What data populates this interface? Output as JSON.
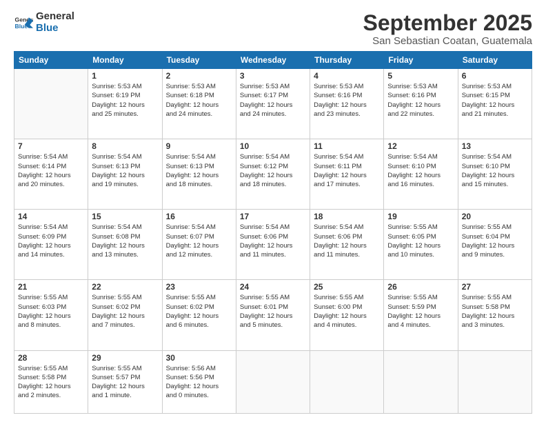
{
  "logo": {
    "text_general": "General",
    "text_blue": "Blue"
  },
  "header": {
    "month": "September 2025",
    "location": "San Sebastian Coatan, Guatemala"
  },
  "days": [
    "Sunday",
    "Monday",
    "Tuesday",
    "Wednesday",
    "Thursday",
    "Friday",
    "Saturday"
  ],
  "weeks": [
    [
      {
        "num": "",
        "lines": []
      },
      {
        "num": "1",
        "lines": [
          "Sunrise: 5:53 AM",
          "Sunset: 6:19 PM",
          "Daylight: 12 hours",
          "and 25 minutes."
        ]
      },
      {
        "num": "2",
        "lines": [
          "Sunrise: 5:53 AM",
          "Sunset: 6:18 PM",
          "Daylight: 12 hours",
          "and 24 minutes."
        ]
      },
      {
        "num": "3",
        "lines": [
          "Sunrise: 5:53 AM",
          "Sunset: 6:17 PM",
          "Daylight: 12 hours",
          "and 24 minutes."
        ]
      },
      {
        "num": "4",
        "lines": [
          "Sunrise: 5:53 AM",
          "Sunset: 6:16 PM",
          "Daylight: 12 hours",
          "and 23 minutes."
        ]
      },
      {
        "num": "5",
        "lines": [
          "Sunrise: 5:53 AM",
          "Sunset: 6:16 PM",
          "Daylight: 12 hours",
          "and 22 minutes."
        ]
      },
      {
        "num": "6",
        "lines": [
          "Sunrise: 5:53 AM",
          "Sunset: 6:15 PM",
          "Daylight: 12 hours",
          "and 21 minutes."
        ]
      }
    ],
    [
      {
        "num": "7",
        "lines": [
          "Sunrise: 5:54 AM",
          "Sunset: 6:14 PM",
          "Daylight: 12 hours",
          "and 20 minutes."
        ]
      },
      {
        "num": "8",
        "lines": [
          "Sunrise: 5:54 AM",
          "Sunset: 6:13 PM",
          "Daylight: 12 hours",
          "and 19 minutes."
        ]
      },
      {
        "num": "9",
        "lines": [
          "Sunrise: 5:54 AM",
          "Sunset: 6:13 PM",
          "Daylight: 12 hours",
          "and 18 minutes."
        ]
      },
      {
        "num": "10",
        "lines": [
          "Sunrise: 5:54 AM",
          "Sunset: 6:12 PM",
          "Daylight: 12 hours",
          "and 18 minutes."
        ]
      },
      {
        "num": "11",
        "lines": [
          "Sunrise: 5:54 AM",
          "Sunset: 6:11 PM",
          "Daylight: 12 hours",
          "and 17 minutes."
        ]
      },
      {
        "num": "12",
        "lines": [
          "Sunrise: 5:54 AM",
          "Sunset: 6:10 PM",
          "Daylight: 12 hours",
          "and 16 minutes."
        ]
      },
      {
        "num": "13",
        "lines": [
          "Sunrise: 5:54 AM",
          "Sunset: 6:10 PM",
          "Daylight: 12 hours",
          "and 15 minutes."
        ]
      }
    ],
    [
      {
        "num": "14",
        "lines": [
          "Sunrise: 5:54 AM",
          "Sunset: 6:09 PM",
          "Daylight: 12 hours",
          "and 14 minutes."
        ]
      },
      {
        "num": "15",
        "lines": [
          "Sunrise: 5:54 AM",
          "Sunset: 6:08 PM",
          "Daylight: 12 hours",
          "and 13 minutes."
        ]
      },
      {
        "num": "16",
        "lines": [
          "Sunrise: 5:54 AM",
          "Sunset: 6:07 PM",
          "Daylight: 12 hours",
          "and 12 minutes."
        ]
      },
      {
        "num": "17",
        "lines": [
          "Sunrise: 5:54 AM",
          "Sunset: 6:06 PM",
          "Daylight: 12 hours",
          "and 11 minutes."
        ]
      },
      {
        "num": "18",
        "lines": [
          "Sunrise: 5:54 AM",
          "Sunset: 6:06 PM",
          "Daylight: 12 hours",
          "and 11 minutes."
        ]
      },
      {
        "num": "19",
        "lines": [
          "Sunrise: 5:55 AM",
          "Sunset: 6:05 PM",
          "Daylight: 12 hours",
          "and 10 minutes."
        ]
      },
      {
        "num": "20",
        "lines": [
          "Sunrise: 5:55 AM",
          "Sunset: 6:04 PM",
          "Daylight: 12 hours",
          "and 9 minutes."
        ]
      }
    ],
    [
      {
        "num": "21",
        "lines": [
          "Sunrise: 5:55 AM",
          "Sunset: 6:03 PM",
          "Daylight: 12 hours",
          "and 8 minutes."
        ]
      },
      {
        "num": "22",
        "lines": [
          "Sunrise: 5:55 AM",
          "Sunset: 6:02 PM",
          "Daylight: 12 hours",
          "and 7 minutes."
        ]
      },
      {
        "num": "23",
        "lines": [
          "Sunrise: 5:55 AM",
          "Sunset: 6:02 PM",
          "Daylight: 12 hours",
          "and 6 minutes."
        ]
      },
      {
        "num": "24",
        "lines": [
          "Sunrise: 5:55 AM",
          "Sunset: 6:01 PM",
          "Daylight: 12 hours",
          "and 5 minutes."
        ]
      },
      {
        "num": "25",
        "lines": [
          "Sunrise: 5:55 AM",
          "Sunset: 6:00 PM",
          "Daylight: 12 hours",
          "and 4 minutes."
        ]
      },
      {
        "num": "26",
        "lines": [
          "Sunrise: 5:55 AM",
          "Sunset: 5:59 PM",
          "Daylight: 12 hours",
          "and 4 minutes."
        ]
      },
      {
        "num": "27",
        "lines": [
          "Sunrise: 5:55 AM",
          "Sunset: 5:58 PM",
          "Daylight: 12 hours",
          "and 3 minutes."
        ]
      }
    ],
    [
      {
        "num": "28",
        "lines": [
          "Sunrise: 5:55 AM",
          "Sunset: 5:58 PM",
          "Daylight: 12 hours",
          "and 2 minutes."
        ]
      },
      {
        "num": "29",
        "lines": [
          "Sunrise: 5:55 AM",
          "Sunset: 5:57 PM",
          "Daylight: 12 hours",
          "and 1 minute."
        ]
      },
      {
        "num": "30",
        "lines": [
          "Sunrise: 5:56 AM",
          "Sunset: 5:56 PM",
          "Daylight: 12 hours",
          "and 0 minutes."
        ]
      },
      {
        "num": "",
        "lines": []
      },
      {
        "num": "",
        "lines": []
      },
      {
        "num": "",
        "lines": []
      },
      {
        "num": "",
        "lines": []
      }
    ]
  ]
}
